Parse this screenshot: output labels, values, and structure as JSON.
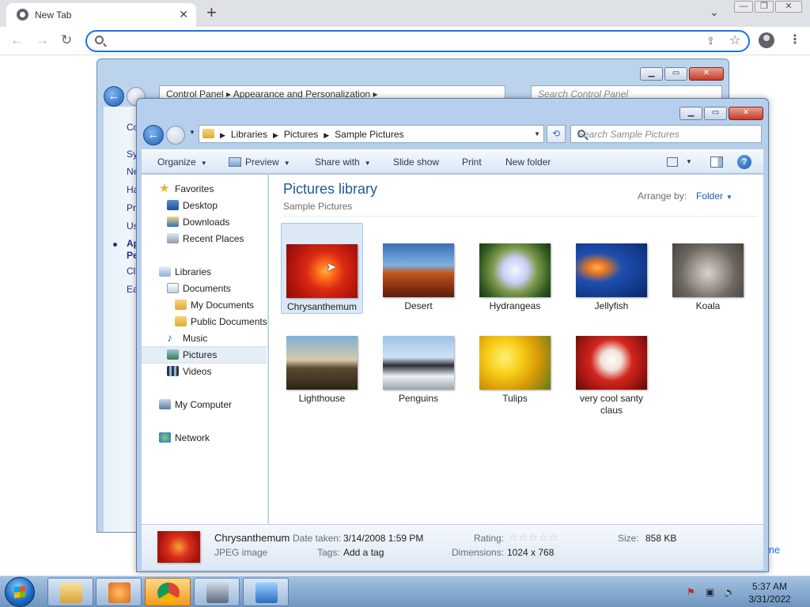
{
  "chrome": {
    "tab_title": "New Tab",
    "tab_close": "✕",
    "new_tab": "+",
    "tabstrip_chevron": "⌄",
    "window_buttons": [
      "—",
      "❐",
      "✕"
    ],
    "omnibox_placeholder": "",
    "page_fragment": "me"
  },
  "control_panel": {
    "address": "Control Panel  ▸  Appearance and Personalization  ▸",
    "search_placeholder": "Search Control Panel",
    "side_items": [
      "Co",
      "Sy",
      "Ne",
      "Ha",
      "Pr",
      "Us",
      "Ap",
      "Pe",
      "Cl",
      "Ea"
    ]
  },
  "explorer": {
    "breadcrumbs": [
      "Libraries",
      "Pictures",
      "Sample Pictures"
    ],
    "search_placeholder": "Search Sample Pictures",
    "commands": {
      "organize": "Organize",
      "preview": "Preview",
      "share_with": "Share with",
      "slide_show": "Slide show",
      "print": "Print",
      "new_folder": "New folder"
    },
    "help": "?",
    "nav": {
      "favorites": "Favorites",
      "desktop": "Desktop",
      "downloads": "Downloads",
      "recent_places": "Recent Places",
      "libraries": "Libraries",
      "documents": "Documents",
      "my_documents": "My Documents",
      "public_documents": "Public Documents",
      "music": "Music",
      "pictures": "Pictures",
      "videos": "Videos",
      "my_computer": "My Computer",
      "network": "Network"
    },
    "library_title": "Pictures library",
    "library_subtitle": "Sample Pictures",
    "arrange_label": "Arrange by:",
    "arrange_value": "Folder",
    "items": [
      {
        "label": "Chrysanthemum",
        "selected": true
      },
      {
        "label": "Desert"
      },
      {
        "label": "Hydrangeas"
      },
      {
        "label": "Jellyfish"
      },
      {
        "label": "Koala"
      },
      {
        "label": "Lighthouse"
      },
      {
        "label": "Penguins"
      },
      {
        "label": "Tulips"
      },
      {
        "label": "very cool santy claus"
      }
    ],
    "details": {
      "name": "Chrysanthemum",
      "type": "JPEG image",
      "date_taken_label": "Date taken:",
      "date_taken": "3/14/2008 1:59 PM",
      "tags_label": "Tags:",
      "tags_value": "Add a tag",
      "rating_label": "Rating:",
      "rating_stars": "☆☆☆☆☆",
      "rating": 0,
      "dimensions_label": "Dimensions:",
      "dimensions": "1024 x 768",
      "size_label": "Size:",
      "size": "858 KB"
    }
  },
  "taskbar": {
    "time": "5:37 AM",
    "date": "3/31/2022"
  }
}
